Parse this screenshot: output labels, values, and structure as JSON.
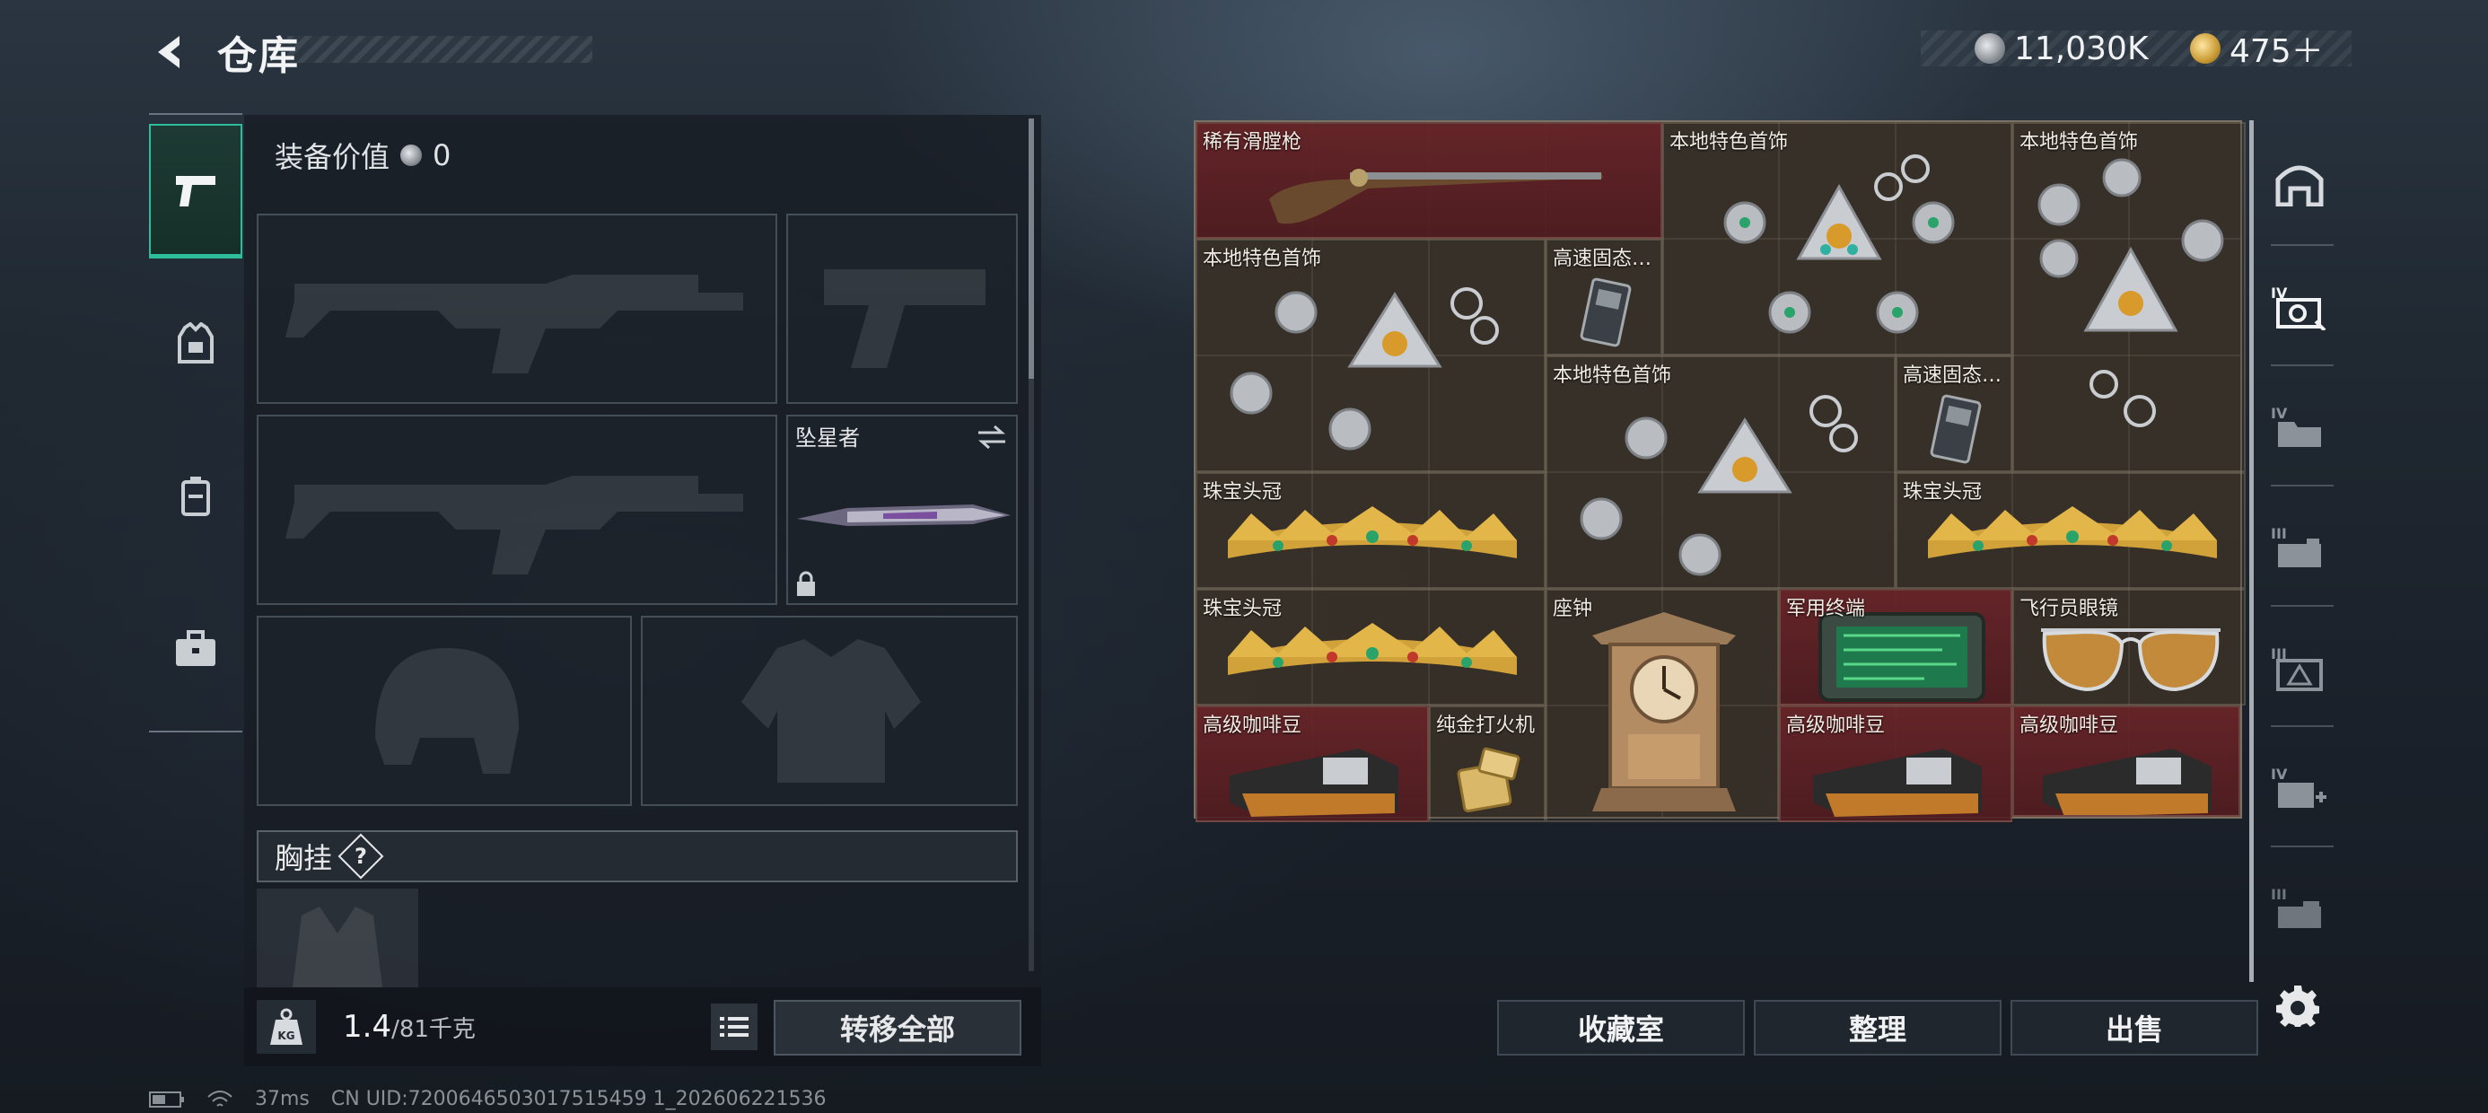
{
  "header": {
    "title": "仓库",
    "currency_silver": "11,030K",
    "currency_gold": "475＋"
  },
  "loadout": {
    "equip_value_label": "装备价值",
    "equip_value": "0",
    "melee_name": "坠星者",
    "chest_label": "胸挂",
    "chest_help": "?",
    "weight_current": "1.4",
    "weight_max": "/81千克",
    "transfer_all": "转移全部"
  },
  "storage": {
    "items": [
      {
        "name": "稀有滑膛枪"
      },
      {
        "name": "本地特色首饰"
      },
      {
        "name": "本地特色首饰"
      },
      {
        "name": "本地特色首饰"
      },
      {
        "name": "高速固态…"
      },
      {
        "name": "本地特色首饰"
      },
      {
        "name": "高速固态…"
      },
      {
        "name": "珠宝头冠"
      },
      {
        "name": "珠宝头冠"
      },
      {
        "name": "珠宝头冠"
      },
      {
        "name": "座钟"
      },
      {
        "name": "军用终端"
      },
      {
        "name": "飞行员眼镜"
      },
      {
        "name": "高级咖啡豆"
      },
      {
        "name": "纯金打火机"
      },
      {
        "name": "高级咖啡豆"
      },
      {
        "name": "高级咖啡豆"
      }
    ]
  },
  "actions": {
    "collection": "收藏室",
    "sort": "整理",
    "sell": "出售"
  },
  "status_bar": {
    "ping": "37ms",
    "uid": "CN UID:7200646503017515459 1_202606221536"
  },
  "colors": {
    "accent": "#2ebd9a",
    "rare_red": "#682428",
    "gold": "#c99a34"
  }
}
